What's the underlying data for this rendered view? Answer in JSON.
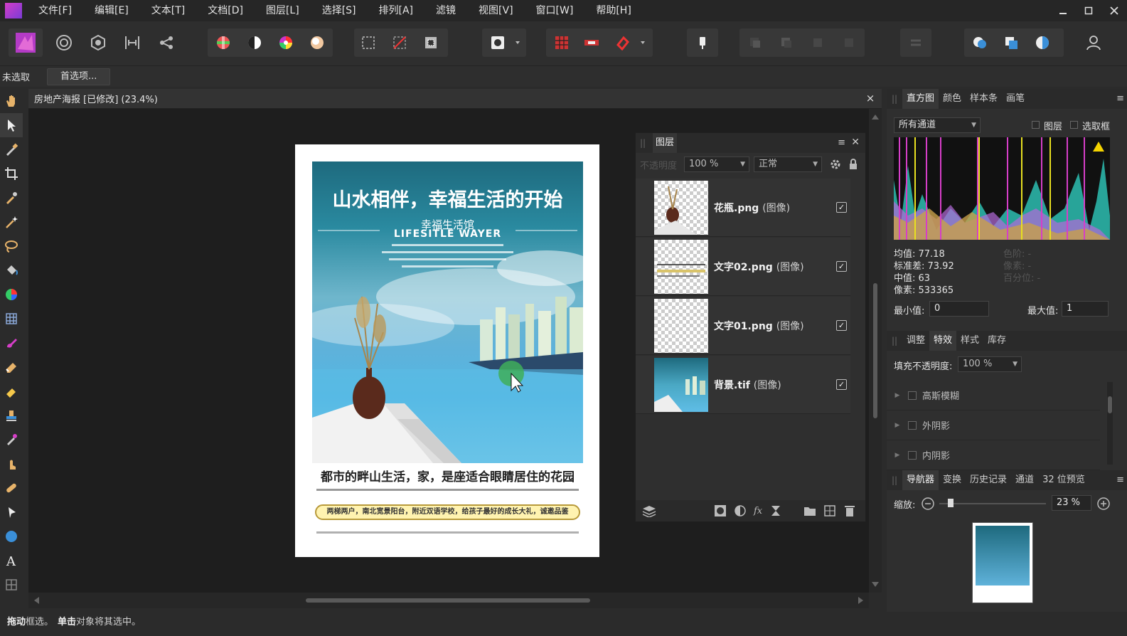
{
  "menubar": {
    "items": [
      "文件[F]",
      "编辑[E]",
      "文本[T]",
      "文档[D]",
      "图层[L]",
      "选择[S]",
      "排列[A]",
      "滤镜",
      "视图[V]",
      "窗口[W]",
      "帮助[H]"
    ]
  },
  "context": {
    "selection_label": "未选取",
    "prefs_button": "首选项..."
  },
  "document": {
    "title": "房地产海报 [已修改] (23.4%)",
    "close": "×"
  },
  "poster": {
    "headline": "山水相伴，幸福生活的开始",
    "subtitle_cn": "幸福生活馆",
    "subtitle_en": "LIFESITLE WAYER",
    "slogan": "都市的畔山生活，家，是座适合眼睛居住的花园",
    "banner": "两梯两户，南北宽景阳台，附近双语学校，给孩子最好的成长大礼，诚邀品鉴"
  },
  "layers": {
    "tab": "图层",
    "opacity_label": "不透明度",
    "opacity": "100 %",
    "blend": "正常",
    "items": [
      {
        "name": "花瓶.png",
        "type": "(图像)"
      },
      {
        "name": "文字02.png",
        "type": "(图像)"
      },
      {
        "name": "文字01.png",
        "type": "(图像)"
      },
      {
        "name": "背景.tif",
        "type": "(图像)"
      }
    ],
    "check": "✓"
  },
  "histogram": {
    "tabs": [
      "直方图",
      "颜色",
      "样本条",
      "画笔"
    ],
    "channel": "所有通道",
    "layer_check": "图层",
    "selection_check": "选取框",
    "mean_label": "均值: 77.18",
    "stddev_label": "标准差: 73.92",
    "median_label": "中值: 63",
    "pixels_label": "像素: 533365",
    "levels_label": "色阶: -",
    "count_label": "像素: -",
    "percentile_label": "百分位: -",
    "min_label": "最小值:",
    "min_value": "0",
    "max_label": "最大值:",
    "max_value": "1"
  },
  "effects": {
    "tabs": [
      "调整",
      "特效",
      "样式",
      "库存"
    ],
    "fill_label": "填充不透明度:",
    "fill_value": "100 %",
    "items": [
      "高斯模糊",
      "外阴影",
      "内阴影"
    ]
  },
  "navigator": {
    "tabs": [
      "导航器",
      "变换",
      "历史记录",
      "通道",
      "32 位预览"
    ],
    "zoom_label": "缩放:",
    "zoom_value": "23 %"
  },
  "status": {
    "drag": "拖动",
    "drag_text": " 框选。",
    "click": "单击",
    "click_text": " 对象将其选中。"
  }
}
